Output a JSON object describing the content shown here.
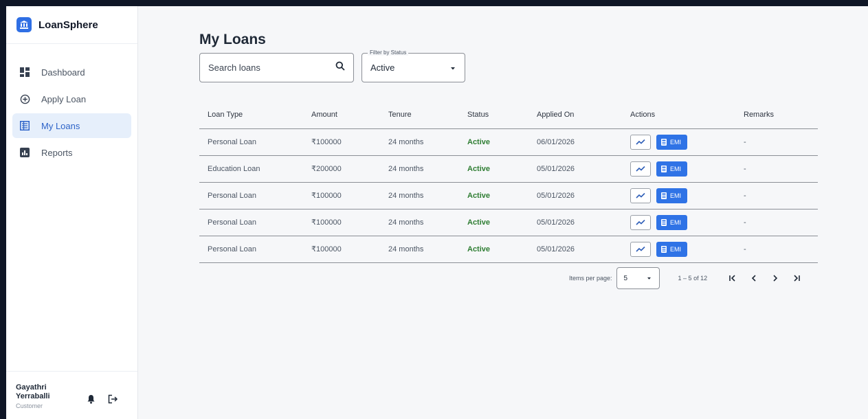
{
  "brand": {
    "name": "LoanSphere"
  },
  "nav": {
    "items": [
      {
        "label": "Dashboard",
        "icon": "dashboard-icon"
      },
      {
        "label": "Apply Loan",
        "icon": "plus-circle-icon"
      },
      {
        "label": "My Loans",
        "icon": "list-icon",
        "active": true
      },
      {
        "label": "Reports",
        "icon": "reports-icon"
      }
    ]
  },
  "user": {
    "name": "Gayathri Yerraballi",
    "role": "Customer"
  },
  "page": {
    "title": "My Loans"
  },
  "search": {
    "placeholder": "Search loans",
    "value": ""
  },
  "filter": {
    "label": "Filter by Status",
    "value": "Active"
  },
  "table": {
    "headers": [
      "Loan Type",
      "Amount",
      "Tenure",
      "Status",
      "Applied On",
      "Actions",
      "Remarks"
    ],
    "rows": [
      {
        "type": "Personal Loan",
        "amount": "₹100000",
        "tenure": "24 months",
        "status": "Active",
        "applied": "06/01/2026",
        "remarks": "-"
      },
      {
        "type": "Education Loan",
        "amount": "₹200000",
        "tenure": "24 months",
        "status": "Active",
        "applied": "05/01/2026",
        "remarks": "-"
      },
      {
        "type": "Personal Loan",
        "amount": "₹100000",
        "tenure": "24 months",
        "status": "Active",
        "applied": "05/01/2026",
        "remarks": "-"
      },
      {
        "type": "Personal Loan",
        "amount": "₹100000",
        "tenure": "24 months",
        "status": "Active",
        "applied": "05/01/2026",
        "remarks": "-"
      },
      {
        "type": "Personal Loan",
        "amount": "₹100000",
        "tenure": "24 months",
        "status": "Active",
        "applied": "05/01/2026",
        "remarks": "-"
      }
    ],
    "emi_label": "EMI"
  },
  "pagination": {
    "items_per_page_label": "Items per page:",
    "items_per_page": "5",
    "range": "1 – 5 of 12"
  },
  "colors": {
    "accent": "#2f73e6",
    "status_active": "#2e7d32",
    "nav_active_bg": "#e6effb"
  }
}
